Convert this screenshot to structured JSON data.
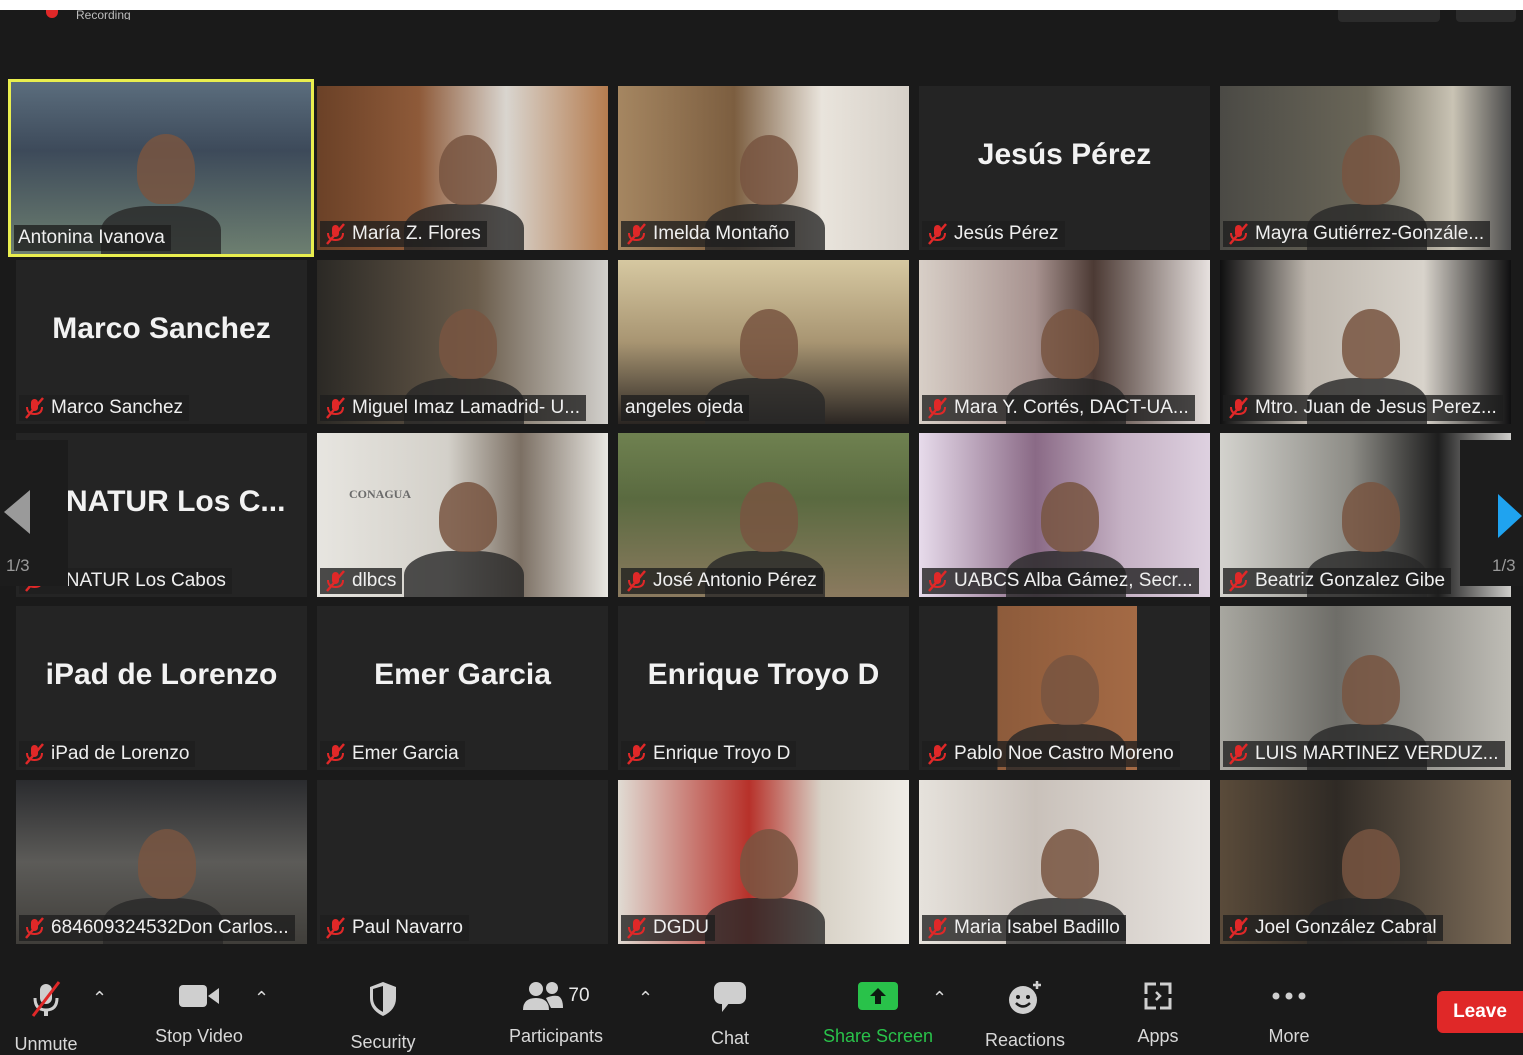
{
  "app": "Zoom Meeting",
  "recording": {
    "label": "Recording"
  },
  "accent_colors": {
    "active_speaker": "#e9ee4e",
    "share": "#29c24a",
    "leave": "#e02828",
    "next_page_arrow": "#1fa3f0"
  },
  "pager": {
    "left_label": "1/3",
    "right_label": "1/3"
  },
  "tiles": [
    {
      "name": "Antonina Ivanova",
      "big_name": "",
      "muted": false,
      "active": true,
      "video": "v-books"
    },
    {
      "name": "María Z. Flores",
      "big_name": "",
      "muted": true,
      "video": "v-wood"
    },
    {
      "name": "Imelda Montaño",
      "big_name": "",
      "muted": true,
      "video": "v-office"
    },
    {
      "name": "Jesús Pérez",
      "big_name": "Jesús Pérez",
      "muted": true,
      "video": ""
    },
    {
      "name": "Mayra Gutiérrez-Gonzále...",
      "big_name": "",
      "muted": true,
      "video": "v-glasses"
    },
    {
      "name": "Marco Sanchez",
      "big_name": "Marco Sanchez",
      "muted": true,
      "video": ""
    },
    {
      "name": "Miguel Imaz Lamadrid- U...",
      "big_name": "",
      "muted": true,
      "video": "v-dark1"
    },
    {
      "name": "angeles ojeda",
      "big_name": "",
      "muted": false,
      "video": "v-map"
    },
    {
      "name": "Mara Y. Cortés, DACT-UA...",
      "big_name": "",
      "muted": true,
      "video": "v-curtain"
    },
    {
      "name": "Mtro. Juan de Jesus Perez...",
      "big_name": "",
      "muted": true,
      "video": "v-elder"
    },
    {
      "name": "ONATUR Los Cabos",
      "big_name": "NATUR Los C...",
      "muted": true,
      "video": ""
    },
    {
      "name": "dlbcs",
      "big_name": "",
      "muted": true,
      "video": "v-conagua"
    },
    {
      "name": "José Antonio Pérez",
      "big_name": "",
      "muted": true,
      "video": "v-agave"
    },
    {
      "name": "UABCS Alba Gámez, Secr...",
      "big_name": "",
      "muted": true,
      "video": "v-purple"
    },
    {
      "name": "Beatriz Gonzalez Gibe",
      "big_name": "",
      "muted": true,
      "video": "v-blur"
    },
    {
      "name": "iPad de Lorenzo",
      "big_name": "iPad de Lorenzo",
      "muted": true,
      "video": ""
    },
    {
      "name": "Emer Garcia",
      "big_name": "Emer Garcia",
      "muted": true,
      "video": ""
    },
    {
      "name": "Enrique Troyo D",
      "big_name": "Enrique Troyo D",
      "muted": true,
      "video": ""
    },
    {
      "name": "Pablo Noe Castro Moreno",
      "big_name": "",
      "muted": true,
      "video": "v-pablo"
    },
    {
      "name": "LUIS MARTINEZ VERDUZ...",
      "big_name": "",
      "muted": true,
      "video": "v-luis"
    },
    {
      "name": "684609324532Don Carlos...",
      "big_name": "",
      "muted": true,
      "video": "v-carlos"
    },
    {
      "name": "Paul Navarro",
      "big_name": "",
      "muted": true,
      "video": ""
    },
    {
      "name": "DGDU",
      "big_name": "",
      "muted": true,
      "video": "v-dgdu"
    },
    {
      "name": "Maria Isabel Badillo",
      "big_name": "",
      "muted": true,
      "video": "v-isabel"
    },
    {
      "name": "Joel González Cabral",
      "big_name": "",
      "muted": true,
      "video": "v-joel"
    }
  ],
  "conagua_sign": "CONAGUA",
  "toolbar": {
    "unmute": "Unmute",
    "stop_video": "Stop Video",
    "security": "Security",
    "participants": "Participants",
    "participants_count": "70",
    "chat": "Chat",
    "share_screen": "Share Screen",
    "reactions": "Reactions",
    "apps": "Apps",
    "more": "More",
    "leave": "Leave"
  }
}
